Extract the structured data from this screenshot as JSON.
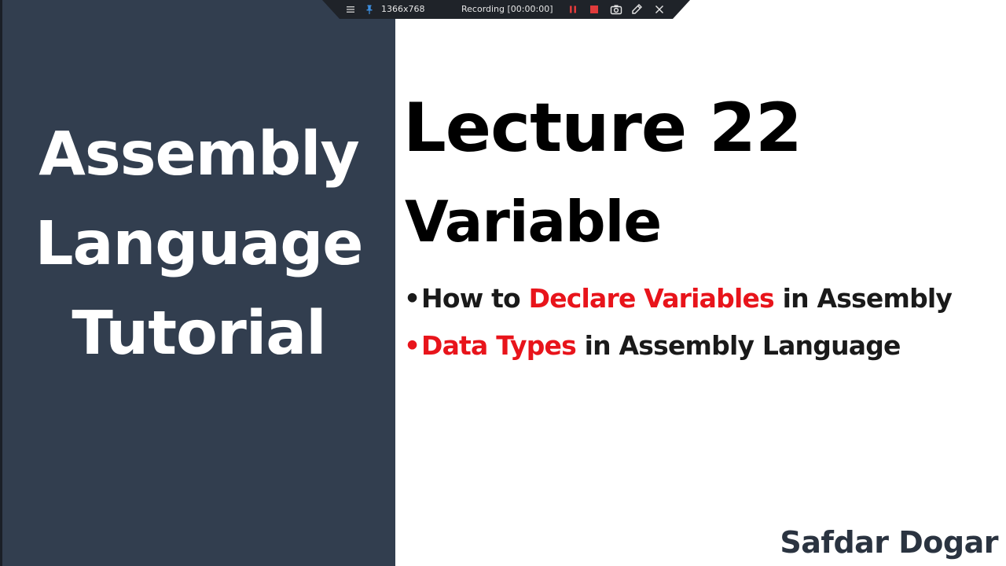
{
  "slide": {
    "series_title": [
      "Assembly",
      "Language",
      "Tutorial"
    ],
    "lecture": "Lecture 22",
    "topic": "Variable",
    "bullets": [
      {
        "marker": "•",
        "segments": [
          {
            "text": "How to ",
            "color": "#1a1a1a"
          },
          {
            "text": "Declare Variables",
            "color": "#e8141b"
          },
          {
            "text": " in Assembly",
            "color": "#1a1a1a"
          }
        ]
      },
      {
        "marker": "•",
        "segments": [
          {
            "text": "Data Types",
            "color": "#e8141b"
          },
          {
            "text": " in Assembly Language",
            "color": "#1a1a1a"
          }
        ]
      }
    ],
    "author": "Safdar Dogar"
  },
  "recorder": {
    "resolution": "1366x768",
    "status": "Recording [00:00:00]",
    "icons": [
      "menu-icon",
      "pin-icon",
      "pause-icon",
      "stop-icon",
      "camera-icon",
      "pencil-icon",
      "close-icon"
    ]
  },
  "colors": {
    "panel": "#323e4f",
    "accent_red": "#e8141b",
    "toolbar": "#1f2329"
  }
}
